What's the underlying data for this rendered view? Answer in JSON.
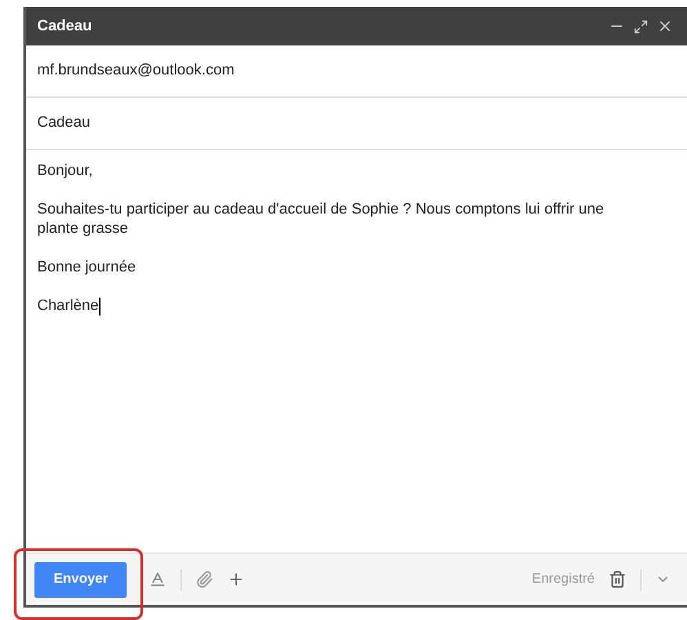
{
  "window": {
    "title": "Cadeau"
  },
  "to": {
    "value": "mf.brundseaux@outlook.com"
  },
  "subject": {
    "value": "Cadeau"
  },
  "body": {
    "paragraphs": [
      "Bonjour,",
      "Souhaites-tu participer au cadeau d'accueil de Sophie ? Nous comptons lui offrir une plante grasse",
      "Bonne journée",
      "Charlène"
    ],
    "cursor": true
  },
  "toolbar": {
    "send": {
      "label": "Envoyer",
      "highlighted": true
    },
    "status": "Enregistré"
  }
}
